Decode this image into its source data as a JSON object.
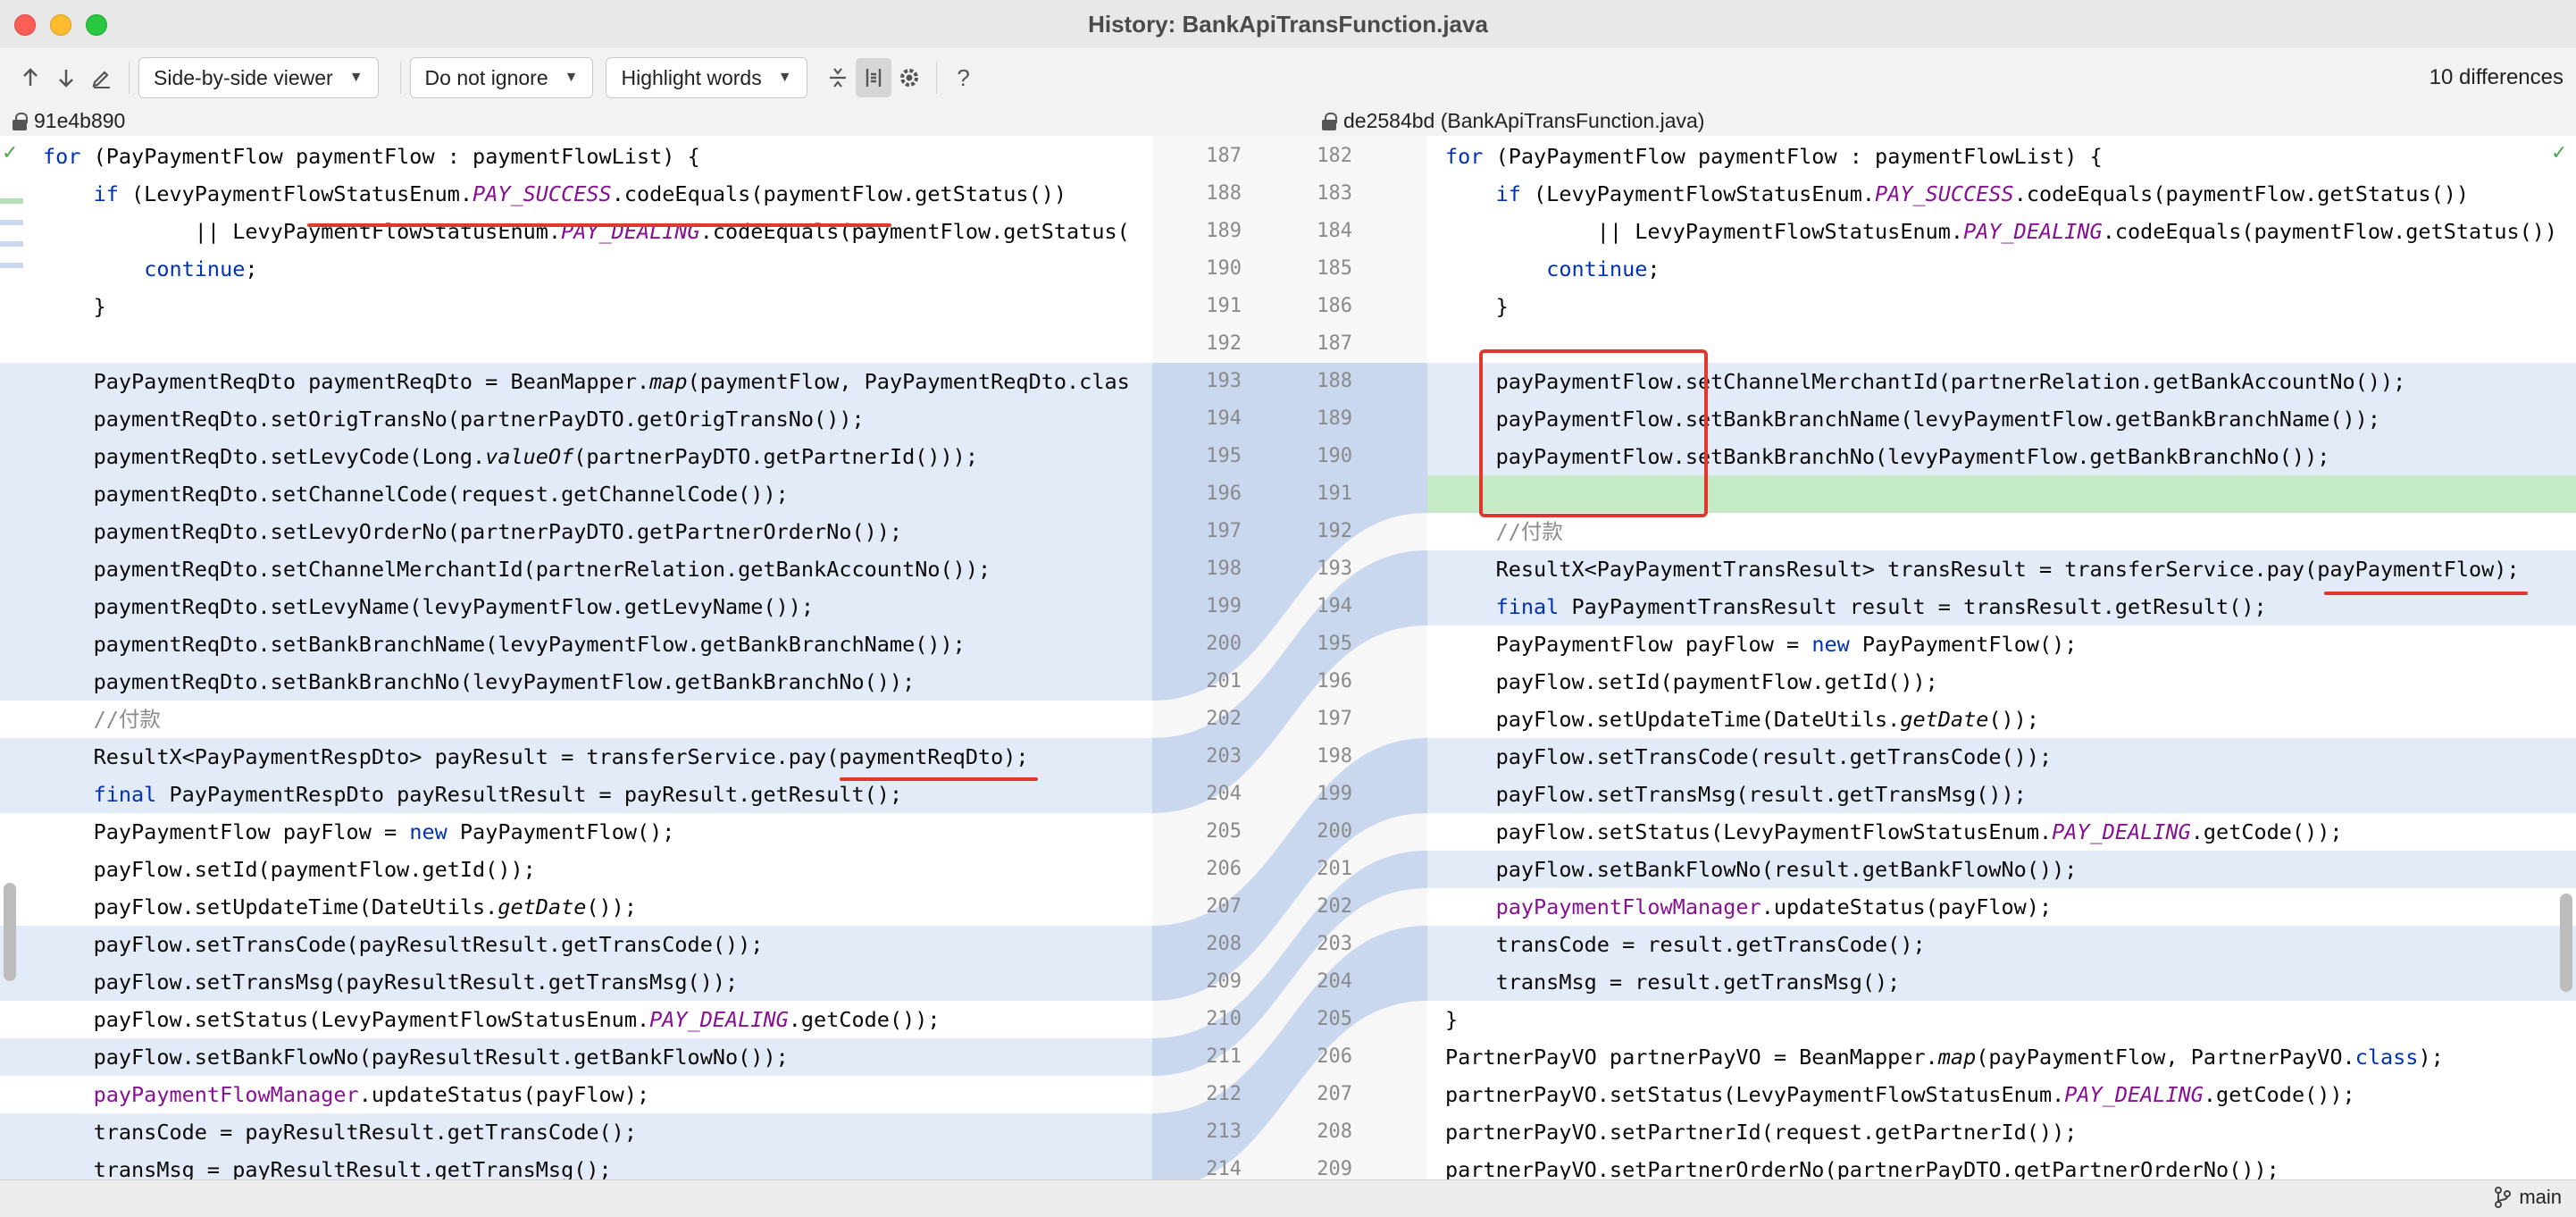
{
  "window": {
    "title": "History: BankApiTransFunction.java"
  },
  "toolbar": {
    "viewer_mode": "Side-by-side viewer",
    "whitespace_mode": "Do not ignore",
    "highlight_mode": "Highlight words",
    "help_label": "?",
    "differences": "10 differences"
  },
  "revisions": {
    "left": "91e4b890",
    "right": "de2584bd (BankApiTransFunction.java)"
  },
  "left_numbers": [
    "187",
    "188",
    "189",
    "190",
    "191",
    "192",
    "193",
    "194",
    "195",
    "196",
    "197",
    "198",
    "199",
    "200",
    "201",
    "202",
    "203",
    "204",
    "205",
    "206",
    "207",
    "208",
    "209",
    "210",
    "211",
    "212",
    "213",
    "214"
  ],
  "right_numbers": [
    "182",
    "183",
    "184",
    "185",
    "186",
    "187",
    "188",
    "189",
    "190",
    "191",
    "192",
    "193",
    "194",
    "195",
    "196",
    "197",
    "198",
    "199",
    "200",
    "201",
    "202",
    "203",
    "204",
    "205",
    "206",
    "207",
    "208",
    "209"
  ],
  "left_lines": [
    "for (PayPaymentFlow paymentFlow : paymentFlowList) {",
    "    if (LevyPaymentFlowStatusEnum.PAY_SUCCESS.codeEquals(paymentFlow.getStatus())",
    "            || LevyPaymentFlowStatusEnum.PAY_DEALING.codeEquals(paymentFlow.getStatus(",
    "        continue;",
    "    }",
    "",
    "    PayPaymentReqDto paymentReqDto = BeanMapper.map(paymentFlow, PayPaymentReqDto.clas",
    "    paymentReqDto.setOrigTransNo(partnerPayDTO.getOrigTransNo());",
    "    paymentReqDto.setLevyCode(Long.valueOf(partnerPayDTO.getPartnerId()));",
    "    paymentReqDto.setChannelCode(request.getChannelCode());",
    "    paymentReqDto.setLevyOrderNo(partnerPayDTO.getPartnerOrderNo());",
    "    paymentReqDto.setChannelMerchantId(partnerRelation.getBankAccountNo());",
    "    paymentReqDto.setLevyName(levyPaymentFlow.getLevyName());",
    "    paymentReqDto.setBankBranchName(levyPaymentFlow.getBankBranchName());",
    "    paymentReqDto.setBankBranchNo(levyPaymentFlow.getBankBranchNo());",
    "    //付款",
    "    ResultX<PayPaymentRespDto> payResult = transferService.pay(paymentReqDto);",
    "    final PayPaymentRespDto payResultResult = payResult.getResult();",
    "    PayPaymentFlow payFlow = new PayPaymentFlow();",
    "    payFlow.setId(paymentFlow.getId());",
    "    payFlow.setUpdateTime(DateUtils.getDate());",
    "    payFlow.setTransCode(payResultResult.getTransCode());",
    "    payFlow.setTransMsg(payResultResult.getTransMsg());",
    "    payFlow.setStatus(LevyPaymentFlowStatusEnum.PAY_DEALING.getCode());",
    "    payFlow.setBankFlowNo(payResultResult.getBankFlowNo());",
    "    payPaymentFlowManager.updateStatus(payFlow);",
    "    transCode = payResultResult.getTransCode();",
    "    transMsg = payResultResult.getTransMsg();"
  ],
  "right_lines": [
    "for (PayPaymentFlow paymentFlow : paymentFlowList) {",
    "    if (LevyPaymentFlowStatusEnum.PAY_SUCCESS.codeEquals(paymentFlow.getStatus())",
    "            || LevyPaymentFlowStatusEnum.PAY_DEALING.codeEquals(paymentFlow.getStatus())",
    "        continue;",
    "    }",
    "",
    "    payPaymentFlow.setChannelMerchantId(partnerRelation.getBankAccountNo());",
    "    payPaymentFlow.setBankBranchName(levyPaymentFlow.getBankBranchName());",
    "    payPaymentFlow.setBankBranchNo(levyPaymentFlow.getBankBranchNo());",
    "",
    "    //付款",
    "    ResultX<PayPaymentTransResult> transResult = transferService.pay(payPaymentFlow);",
    "    final PayPaymentTransResult result = transResult.getResult();",
    "    PayPaymentFlow payFlow = new PayPaymentFlow();",
    "    payFlow.setId(paymentFlow.getId());",
    "    payFlow.setUpdateTime(DateUtils.getDate());",
    "    payFlow.setTransCode(result.getTransCode());",
    "    payFlow.setTransMsg(result.getTransMsg());",
    "    payFlow.setStatus(LevyPaymentFlowStatusEnum.PAY_DEALING.getCode());",
    "    payFlow.setBankFlowNo(result.getBankFlowNo());",
    "    payPaymentFlowManager.updateStatus(payFlow);",
    "    transCode = result.getTransCode();",
    "    transMsg = result.getTransMsg();",
    "}",
    "PartnerPayVO partnerPayVO = BeanMapper.map(payPaymentFlow, PartnerPayVO.class);",
    "partnerPayVO.setStatus(LevyPaymentFlowStatusEnum.PAY_DEALING.getCode());",
    "partnerPayVO.setPartnerId(request.getPartnerId());",
    "partnerPayVO.setPartnerOrderNo(partnerPayDTO.getPartnerOrderNo());"
  ],
  "left_highlight": [
    "none",
    "none",
    "none",
    "none",
    "none",
    "none",
    "mod",
    "mod",
    "mod",
    "mod",
    "mod",
    "mod",
    "mod",
    "mod",
    "mod",
    "none",
    "mod",
    "mod",
    "none",
    "none",
    "none",
    "mod",
    "mod",
    "none",
    "mod",
    "none",
    "mod",
    "mod"
  ],
  "right_highlight": [
    "none",
    "none",
    "none",
    "none",
    "none",
    "none",
    "mod",
    "mod",
    "mod",
    "ins",
    "none",
    "mod",
    "mod",
    "none",
    "none",
    "none",
    "mod",
    "mod",
    "none",
    "mod",
    "none",
    "mod",
    "mod",
    "none",
    "none",
    "none",
    "none",
    "none"
  ],
  "statusbar": {
    "branch": "main"
  },
  "colors": {
    "modified": "#e3ebf8",
    "inserted": "#c4ebc5",
    "annotation": "#e0382c"
  }
}
